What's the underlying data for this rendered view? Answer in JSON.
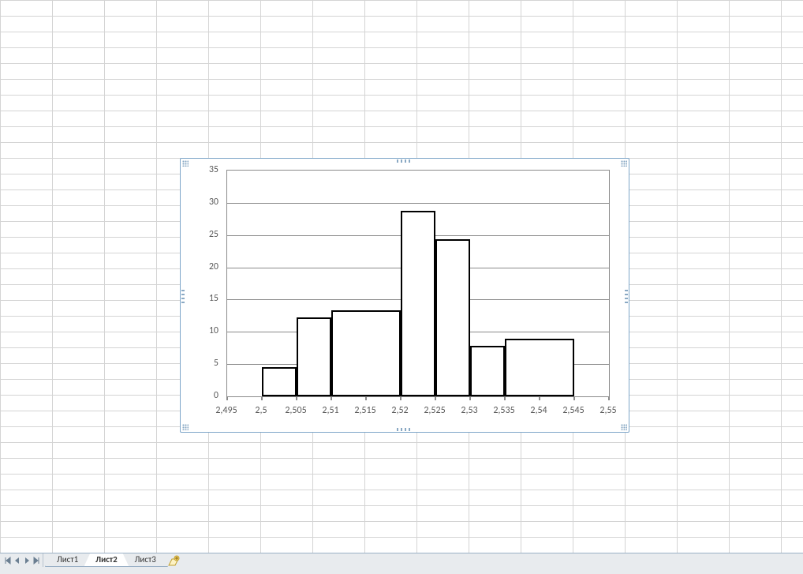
{
  "chart_data": {
    "type": "bar",
    "x_ticks": [
      "2,495",
      "2,5",
      "2,505",
      "2,51",
      "2,515",
      "2,52",
      "2,525",
      "2,53",
      "2,535",
      "2,54",
      "2,545",
      "2,55"
    ],
    "y_ticks": [
      0,
      5,
      10,
      15,
      20,
      25,
      30,
      35
    ],
    "ylim": [
      0,
      35
    ],
    "xlim": [
      2.495,
      2.55
    ],
    "xlabel": "",
    "ylabel": "",
    "title": "",
    "bars": [
      {
        "x_start": 2.5,
        "x_end": 2.505,
        "value": 4.5
      },
      {
        "x_start": 2.505,
        "x_end": 2.51,
        "value": 12.2
      },
      {
        "x_start": 2.51,
        "x_end": 2.52,
        "value": 13.3
      },
      {
        "x_start": 2.52,
        "x_end": 2.525,
        "value": 28.8
      },
      {
        "x_start": 2.525,
        "x_end": 2.53,
        "value": 24.3
      },
      {
        "x_start": 2.53,
        "x_end": 2.535,
        "value": 7.8
      },
      {
        "x_start": 2.535,
        "x_end": 2.545,
        "value": 8.9
      }
    ]
  },
  "tabs": {
    "sheet1": "Лист1",
    "sheet2": "Лист2",
    "sheet3": "Лист3",
    "active_index": 1
  }
}
